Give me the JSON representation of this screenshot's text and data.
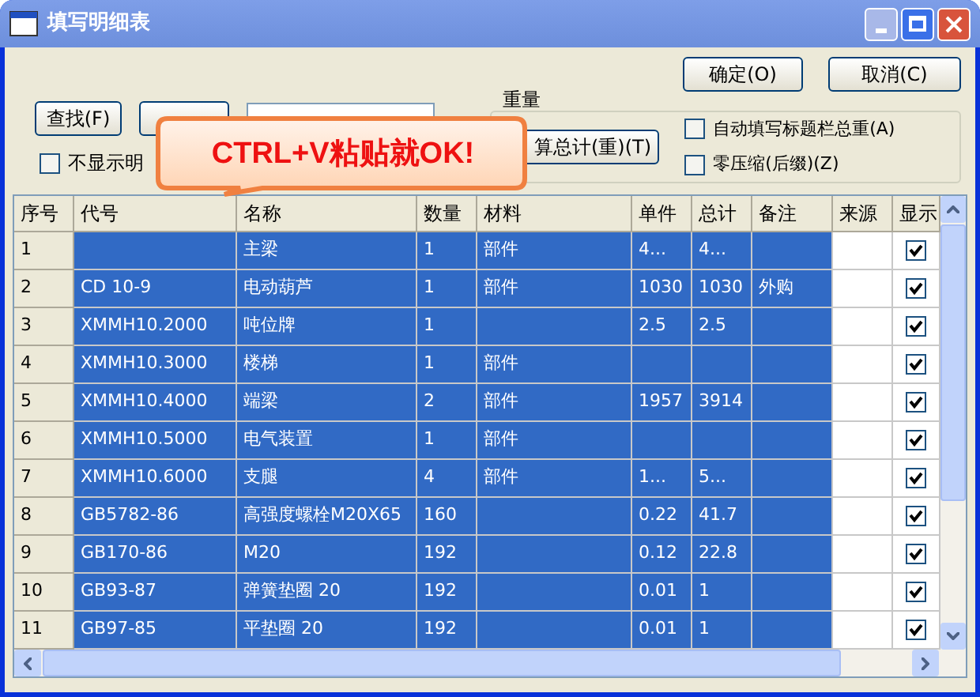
{
  "window": {
    "title": "填写明细表"
  },
  "buttons": [
    {
      "label": "确定(O)"
    },
    {
      "label": "取消(C)"
    }
  ],
  "toolbar": {
    "find_button": "查找(F)",
    "hide_detail_checkbox": {
      "label": "不显示明",
      "checked": false
    }
  },
  "weight_group": {
    "title": "重量",
    "calc_button": "算总计(重)(T)",
    "options": [
      {
        "label": "自动填写标题栏总重(A)",
        "checked": false
      },
      {
        "label": "零压缩(后缀)(Z)",
        "checked": false
      }
    ]
  },
  "callout": {
    "text": "CTRL+V粘贴就OK!"
  },
  "table": {
    "columns": [
      "序号",
      "代号",
      "名称",
      "数量",
      "材料",
      "单件",
      "总计",
      "备注",
      "来源",
      "显示"
    ],
    "rows": [
      {
        "cells": [
          "1",
          "",
          "主梁",
          "1",
          "部件",
          "4...",
          "4...",
          "",
          ""
        ],
        "selected": true,
        "show": true
      },
      {
        "cells": [
          "2",
          "CD 10-9",
          "电动葫芦",
          "1",
          "部件",
          "1030",
          "1030",
          "外购",
          ""
        ],
        "selected": true,
        "show": true
      },
      {
        "cells": [
          "3",
          "XMMH10.2000",
          "吨位牌",
          "1",
          "",
          "2.5",
          "2.5",
          "",
          ""
        ],
        "selected": true,
        "show": true
      },
      {
        "cells": [
          "4",
          "XMMH10.3000",
          "楼梯",
          "1",
          "部件",
          "",
          "",
          "",
          ""
        ],
        "selected": true,
        "show": true
      },
      {
        "cells": [
          "5",
          "XMMH10.4000",
          "端梁",
          "2",
          "部件",
          "1957",
          "3914",
          "",
          ""
        ],
        "selected": true,
        "show": true
      },
      {
        "cells": [
          "6",
          "XMMH10.5000",
          "电气装置",
          "1",
          "部件",
          "",
          "",
          "",
          ""
        ],
        "selected": true,
        "show": true
      },
      {
        "cells": [
          "7",
          "XMMH10.6000",
          "支腿",
          "4",
          "部件",
          "1...",
          "5...",
          "",
          ""
        ],
        "selected": true,
        "show": true
      },
      {
        "cells": [
          "8",
          "GB5782-86",
          "高强度螺栓M20X65",
          "160",
          "",
          "0.22",
          "41.7",
          "",
          ""
        ],
        "selected": true,
        "show": true
      },
      {
        "cells": [
          "9",
          "GB170-86",
          "M20",
          "192",
          "",
          "0.12",
          "22.8",
          "",
          ""
        ],
        "selected": true,
        "show": true
      },
      {
        "cells": [
          "10",
          "GB93-87",
          "弹簧垫圈 20",
          "192",
          "",
          "0.01",
          "1",
          "",
          ""
        ],
        "selected": true,
        "show": true
      },
      {
        "cells": [
          "11",
          "GB97-85",
          "平垫圈 20",
          "192",
          "",
          "0.01",
          "1",
          "",
          ""
        ],
        "selected": true,
        "show": true
      }
    ]
  }
}
